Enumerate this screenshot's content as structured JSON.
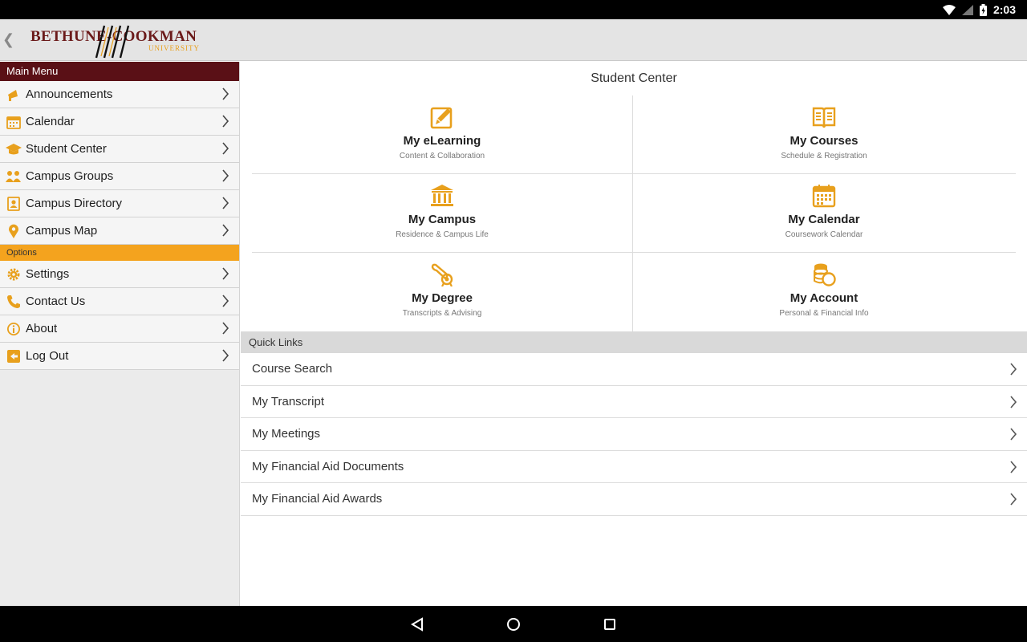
{
  "status_bar": {
    "time": "2:03"
  },
  "header": {
    "logo_line1": "BETHUNE-COOKMAN",
    "logo_line2": "UNIVERSITY",
    "back_icon": "chevron-left-icon"
  },
  "sidebar": {
    "main_menu_label": "Main Menu",
    "main_items": [
      {
        "label": "Announcements",
        "icon": "megaphone-icon"
      },
      {
        "label": "Calendar",
        "icon": "calendar-icon"
      },
      {
        "label": "Student Center",
        "icon": "graduation-cap-icon"
      },
      {
        "label": "Campus Groups",
        "icon": "group-icon"
      },
      {
        "label": "Campus Directory",
        "icon": "contact-card-icon"
      },
      {
        "label": "Campus Map",
        "icon": "map-pin-icon"
      }
    ],
    "options_label": "Options",
    "option_items": [
      {
        "label": "Settings",
        "icon": "gear-icon"
      },
      {
        "label": "Contact Us",
        "icon": "phone-icon"
      },
      {
        "label": "About",
        "icon": "info-icon"
      },
      {
        "label": "Log Out",
        "icon": "logout-icon"
      }
    ]
  },
  "main": {
    "title": "Student Center",
    "tiles": [
      {
        "title": "My eLearning",
        "subtitle": "Content & Collaboration",
        "icon": "pencil-note-icon"
      },
      {
        "title": "My Courses",
        "subtitle": "Schedule & Registration",
        "icon": "open-book-icon"
      },
      {
        "title": "My Campus",
        "subtitle": "Residence & Campus Life",
        "icon": "building-columns-icon"
      },
      {
        "title": "My Calendar",
        "subtitle": "Coursework Calendar",
        "icon": "calendar-icon"
      },
      {
        "title": "My Degree",
        "subtitle": "Transcripts & Advising",
        "icon": "diploma-icon"
      },
      {
        "title": "My Account",
        "subtitle": "Personal & Financial Info",
        "icon": "coins-icon"
      }
    ],
    "quick_links_label": "Quick Links",
    "quick_links": [
      {
        "label": "Course Search"
      },
      {
        "label": "My Transcript"
      },
      {
        "label": "My Meetings"
      },
      {
        "label": "My Financial Aid Documents"
      },
      {
        "label": "My Financial Aid Awards"
      }
    ]
  },
  "colors": {
    "maroon": "#5a1016",
    "gold": "#e8a01d",
    "options_bar": "#f4a31e"
  }
}
